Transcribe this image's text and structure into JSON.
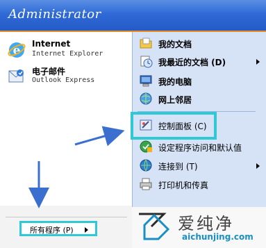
{
  "header": {
    "username": "Administrator"
  },
  "pinned": [
    {
      "title": "Internet",
      "subtitle": "Internet Explorer",
      "icon": "internet-explorer-icon"
    },
    {
      "title": "电子邮件",
      "subtitle": "Outlook Express",
      "icon": "outlook-express-icon"
    }
  ],
  "all_programs": {
    "label": "所有程序 (P)"
  },
  "right_items": [
    {
      "label": "我的文档",
      "icon": "my-documents-icon",
      "bold": true,
      "submenu": false
    },
    {
      "label": "我最近的文档 (D)",
      "icon": "recent-documents-icon",
      "bold": true,
      "submenu": true
    },
    {
      "label": "我的电脑",
      "icon": "my-computer-icon",
      "bold": true,
      "submenu": false
    },
    {
      "label": "网上邻居",
      "icon": "network-places-icon",
      "bold": true,
      "submenu": false
    },
    {
      "label": "控制面板 (C)",
      "icon": "control-panel-icon",
      "bold": false,
      "submenu": false
    },
    {
      "label": "设定程序访问和默认值",
      "icon": "set-defaults-icon",
      "bold": false,
      "submenu": false
    },
    {
      "label": "连接到 (T)",
      "icon": "connect-to-icon",
      "bold": false,
      "submenu": true
    },
    {
      "label": "打印机和传真",
      "icon": "printers-icon",
      "bold": false,
      "submenu": false
    }
  ],
  "watermark": {
    "brand": "爱纯净",
    "url": "aichunjing.com"
  },
  "colors": {
    "header": "#2f6ad6",
    "highlight": "#2fc8d6",
    "arrow": "#3b6fcf",
    "right_panel": "#d6e3f7"
  }
}
